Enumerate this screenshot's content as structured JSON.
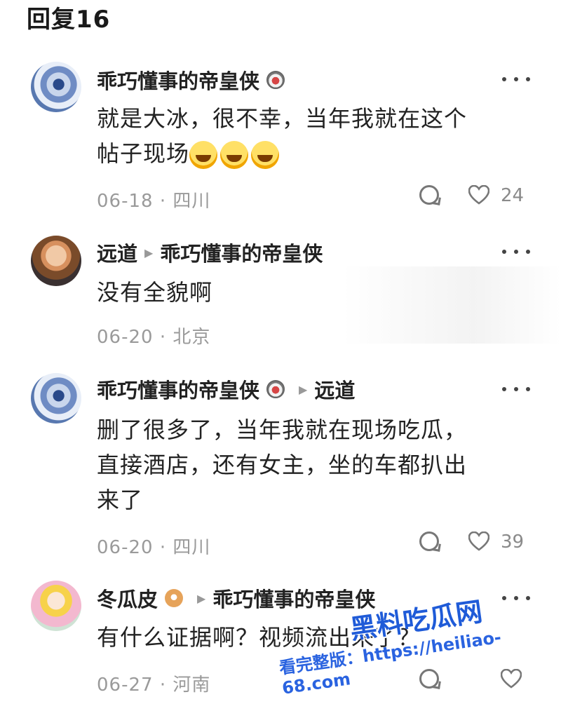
{
  "header": {
    "title": "回复16"
  },
  "comments": [
    {
      "name": "乖巧懂事的帝皇侠",
      "reply_to": "",
      "text_line1": "就是大冰，很不幸，当年我就在这个",
      "text_line2": "帖子现场",
      "date_location": "06-18 · 四川",
      "likes": "24"
    },
    {
      "name": "远道",
      "reply_to": "乖巧懂事的帝皇侠",
      "text_line1": "没有全貌啊",
      "date_location": "06-20 · 北京",
      "likes": ""
    },
    {
      "name": "乖巧懂事的帝皇侠",
      "reply_to": "远道",
      "text_line1": "删了很多了，当年我就在现场吃瓜，",
      "text_line2": "直接酒店，还有女主，坐的车都扒出",
      "text_line3": "来了",
      "date_location": "06-20 · 四川",
      "likes": "39"
    },
    {
      "name": "冬瓜皮",
      "reply_to": "乖巧懂事的帝皇侠",
      "text_line1": "有什么证据啊？视频流出来了？",
      "date_location": "06-27 · 河南",
      "likes": ""
    }
  ],
  "watermark": {
    "brand": "黑料吃瓜网",
    "url": "看完整版：https://heiliao-68.com"
  },
  "icons": [
    "more-icon",
    "reply-icon",
    "heart-icon",
    "avatar",
    "badge-icon"
  ]
}
